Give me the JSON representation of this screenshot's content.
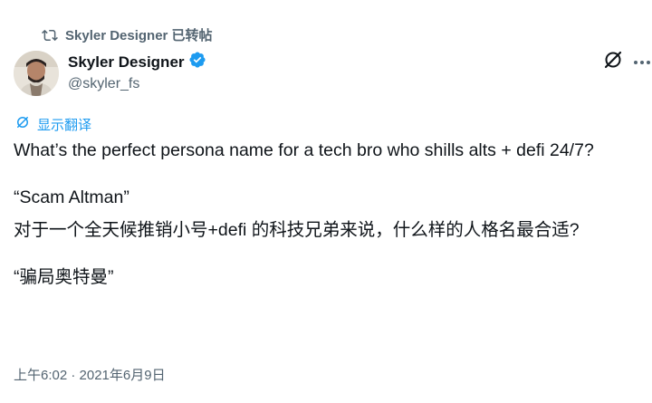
{
  "repost": {
    "text": "Skyler Designer 已转帖"
  },
  "author": {
    "display_name": "Skyler Designer",
    "handle": "@skyler_fs",
    "verified": true
  },
  "translate": {
    "label": "显示翻译"
  },
  "tweet": {
    "paragraphs": [
      "What’s the perfect persona name for a tech bro who shills alts + defi 24/7?",
      "“Scam Altman”",
      "对于一个全天候推销小号+defi 的科技兄弟来说，什么样的人格名最合适?",
      "“骗局奥特曼”"
    ]
  },
  "meta": {
    "timestamp": "上午6:02 · 2021年6月9日"
  },
  "colors": {
    "text": "#0f1419",
    "secondary": "#536471",
    "accent": "#1d9bf0"
  },
  "icons": {
    "repost": "repost-icon",
    "verified": "verified-badge-icon",
    "grok": "grok-icon",
    "more": "more-icon",
    "translate": "translate-icon"
  }
}
